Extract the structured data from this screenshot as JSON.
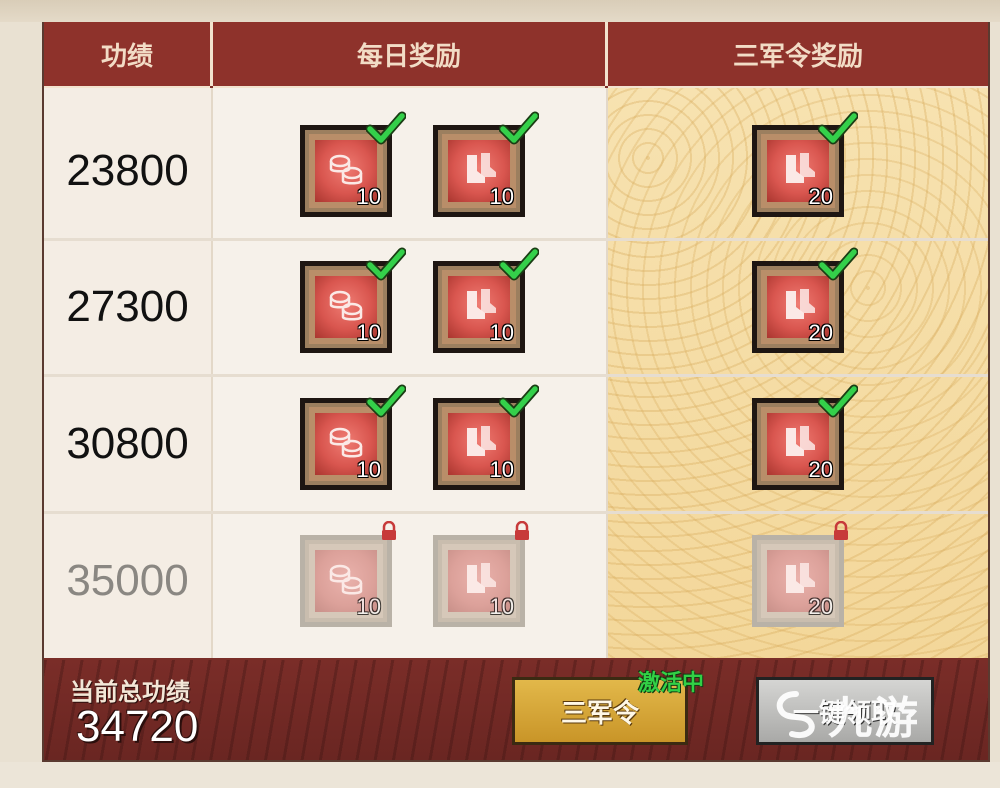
{
  "headers": {
    "score": "功绩",
    "daily": "每日奖励",
    "sanjun": "三军令奖励"
  },
  "rows": [
    {
      "score": "23800",
      "locked": false,
      "daily": [
        {
          "icon": "coin-stack-icon",
          "qty": "10",
          "claimed": true
        },
        {
          "icon": "boots-icon",
          "qty": "10",
          "claimed": true
        }
      ],
      "sanjun": {
        "icon": "boots-icon",
        "qty": "20",
        "claimed": true
      }
    },
    {
      "score": "27300",
      "locked": false,
      "daily": [
        {
          "icon": "coin-stack-icon",
          "qty": "10",
          "claimed": true
        },
        {
          "icon": "boots-icon",
          "qty": "10",
          "claimed": true
        }
      ],
      "sanjun": {
        "icon": "boots-icon",
        "qty": "20",
        "claimed": true
      }
    },
    {
      "score": "30800",
      "locked": false,
      "daily": [
        {
          "icon": "coin-stack-icon",
          "qty": "10",
          "claimed": true
        },
        {
          "icon": "boots-icon",
          "qty": "10",
          "claimed": true
        }
      ],
      "sanjun": {
        "icon": "boots-icon",
        "qty": "20",
        "claimed": true
      }
    },
    {
      "score": "35000",
      "locked": true,
      "daily": [
        {
          "icon": "coin-stack-icon",
          "qty": "10",
          "claimed": false
        },
        {
          "icon": "boots-icon",
          "qty": "10",
          "claimed": false
        }
      ],
      "sanjun": {
        "icon": "boots-icon",
        "qty": "20",
        "claimed": false
      }
    }
  ],
  "footer": {
    "total_label": "当前总功绩",
    "total_value": "34720",
    "sanjun_button": "三军令",
    "active_tag": "激活中",
    "claim_button": "一键领取",
    "watermark": "九游"
  },
  "colors": {
    "header_red": "#8e322b",
    "gold_column": "#f3d79a",
    "check_green": "#2fcf46",
    "button_gold": "#d9a83a"
  }
}
